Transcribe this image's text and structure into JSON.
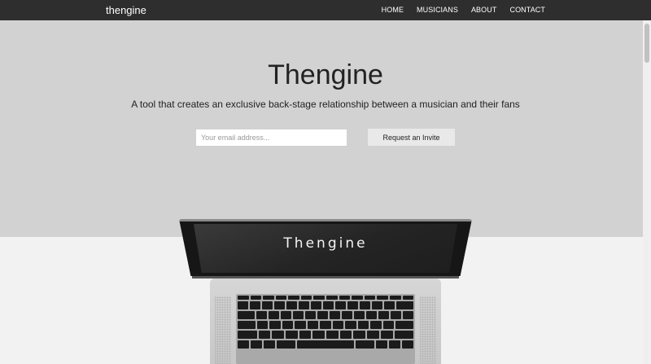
{
  "navbar": {
    "brand": "thengine",
    "links": [
      "HOME",
      "MUSICIANS",
      "ABOUT",
      "CONTACT"
    ]
  },
  "hero": {
    "title": "Thengine",
    "subtitle": "A tool that creates an exclusive back-stage relationship between a musician and their fans",
    "email_placeholder": "Your email address...",
    "invite_label": "Request an Invite"
  },
  "laptop": {
    "screen_text": "Thengine"
  },
  "colors": {
    "navbar": "#2e2e2e",
    "hero_bg": "#d2d2d2",
    "page_bg": "#f2f2f2",
    "button_bg": "#e9e9e9"
  }
}
